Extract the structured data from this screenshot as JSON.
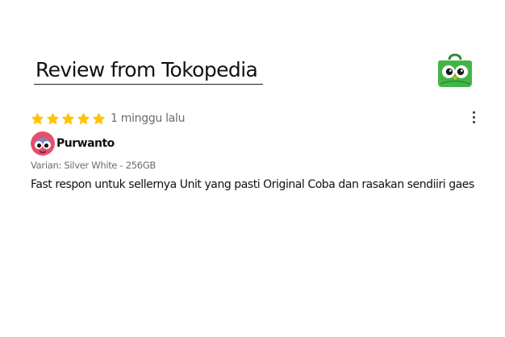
{
  "section": {
    "title": "Review from Tokopedia",
    "logo_icon": "tokopedia-owl-bag-icon"
  },
  "review": {
    "rating": 5,
    "rating_max": 5,
    "star_color": "#FFC400",
    "time_ago": "1 minggu lalu",
    "more_icon": "more-vertical-icon",
    "user": {
      "name": "Purwanto",
      "avatar_icon": "avatar-character-icon"
    },
    "variant": "Varian: Silver White - 256GB",
    "text": "Fast respon untuk sellernya Unit yang pasti Original Coba dan rasakan sendiiri gaes"
  },
  "colors": {
    "brand_green": "#42B549",
    "muted_text": "#6b6b6b"
  }
}
